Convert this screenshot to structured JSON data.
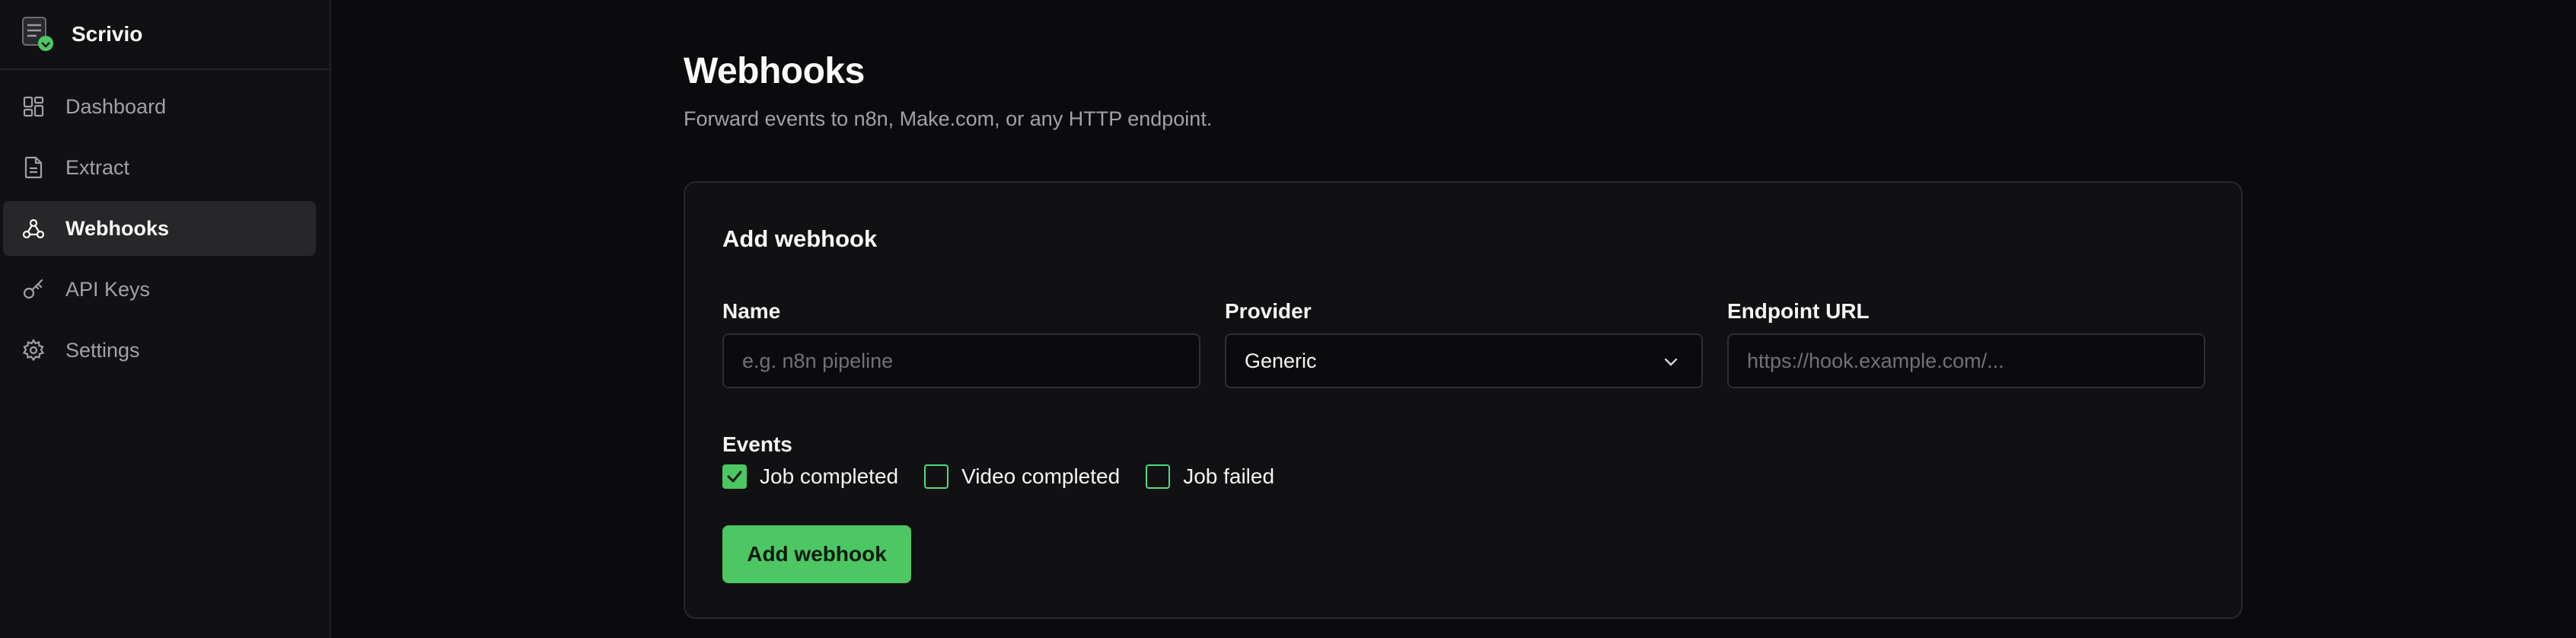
{
  "app": {
    "name": "Scrivio"
  },
  "sidebar": {
    "items": [
      {
        "label": "Dashboard",
        "icon": "dashboard-icon",
        "active": false
      },
      {
        "label": "Extract",
        "icon": "document-icon",
        "active": false
      },
      {
        "label": "Webhooks",
        "icon": "webhook-icon",
        "active": true
      },
      {
        "label": "API Keys",
        "icon": "key-icon",
        "active": false
      },
      {
        "label": "Settings",
        "icon": "gear-icon",
        "active": false
      }
    ]
  },
  "page": {
    "title": "Webhooks",
    "subtitle": "Forward events to n8n, Make.com, or any HTTP endpoint."
  },
  "form": {
    "title": "Add webhook",
    "name": {
      "label": "Name",
      "placeholder": "e.g. n8n pipeline",
      "value": ""
    },
    "provider": {
      "label": "Provider",
      "value": "Generic"
    },
    "endpoint": {
      "label": "Endpoint URL",
      "placeholder": "https://hook.example.com/...",
      "value": ""
    },
    "events": {
      "label": "Events",
      "options": [
        {
          "label": "Job completed",
          "checked": true
        },
        {
          "label": "Video completed",
          "checked": false
        },
        {
          "label": "Job failed",
          "checked": false
        }
      ]
    },
    "submit_label": "Add webhook"
  },
  "colors": {
    "accent": "#4cc764",
    "background": "#0b0b0d",
    "sidebar": "#111113"
  }
}
